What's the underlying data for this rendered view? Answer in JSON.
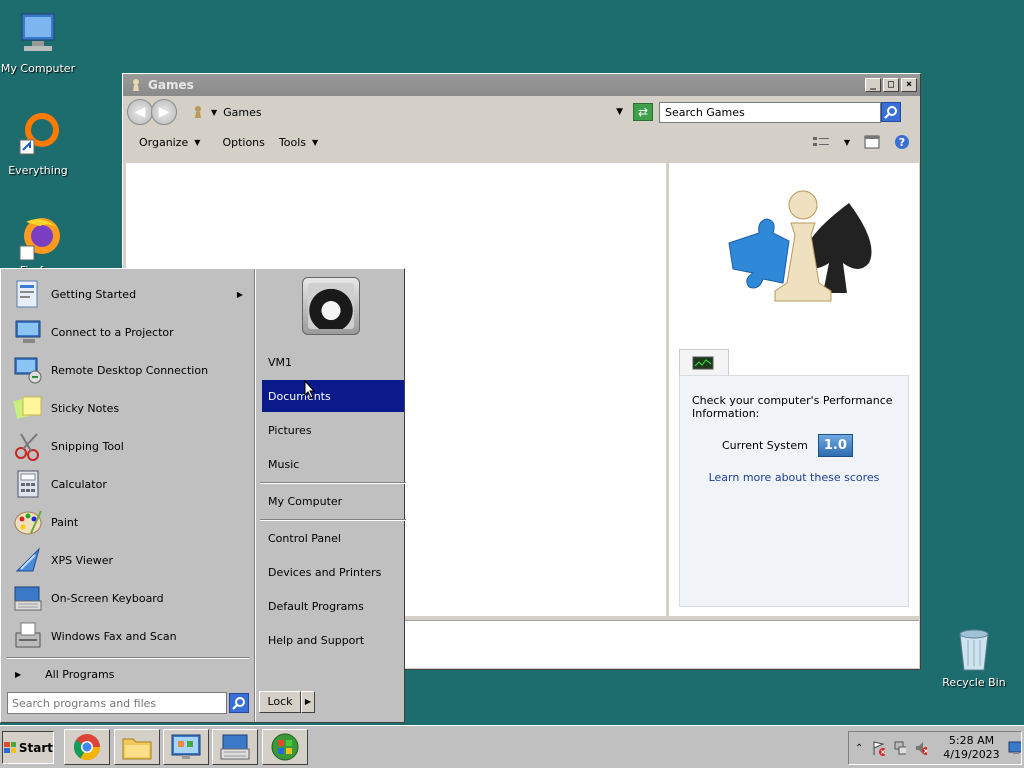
{
  "desktop": {
    "icons": [
      {
        "label": "My Computer"
      },
      {
        "label": "Everything"
      },
      {
        "label": "Firefox"
      },
      {
        "label": "Recycle Bin"
      }
    ]
  },
  "window": {
    "title": "Games",
    "address": "Games",
    "search_placeholder": "Search Games",
    "toolbar": {
      "organize": "Organize",
      "options": "Options",
      "tools": "Tools"
    },
    "perf": {
      "text": "Check your computer's Performance Information:",
      "current_label": "Current System",
      "score": "1.0",
      "link": "Learn more about these scores"
    }
  },
  "start_menu": {
    "programs": [
      {
        "label": "Getting Started"
      },
      {
        "label": "Connect to a Projector"
      },
      {
        "label": "Remote Desktop Connection"
      },
      {
        "label": "Sticky Notes"
      },
      {
        "label": "Snipping Tool"
      },
      {
        "label": "Calculator"
      },
      {
        "label": "Paint"
      },
      {
        "label": "XPS Viewer"
      },
      {
        "label": "On-Screen Keyboard"
      },
      {
        "label": "Windows Fax and Scan"
      }
    ],
    "all_programs": "All Programs",
    "search_placeholder": "Search programs and files",
    "right": {
      "user": "VM1",
      "documents": "Documents",
      "pictures": "Pictures",
      "music": "Music",
      "my_computer": "My Computer",
      "control_panel": "Control Panel",
      "devices": "Devices and Printers",
      "default_programs": "Default Programs",
      "help": "Help and Support"
    },
    "lock": "Lock"
  },
  "taskbar": {
    "start": "Start",
    "time": "5:28 AM",
    "date": "4/19/2023"
  },
  "colors": {
    "desktop": "#1e6d6e",
    "highlight": "#0a1a8a"
  }
}
